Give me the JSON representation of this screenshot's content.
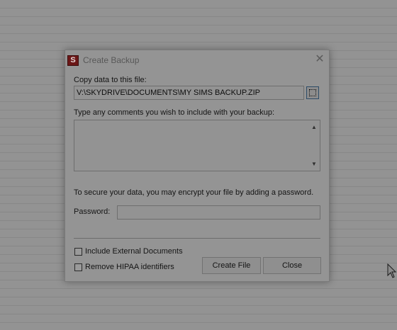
{
  "dialog": {
    "title": "Create Backup",
    "app_icon_letter": "S",
    "close_glyph": "✕",
    "copy_label": "Copy data to this file:",
    "file_path": "V:\\SKYDRIVE\\DOCUMENTS\\MY SIMS BACKUP.ZIP",
    "comments_label": "Type any comments you wish to include with your backup:",
    "comments_value": "",
    "encrypt_note": "To secure your data, you may encrypt your file by adding a password.",
    "password_label": "Password:",
    "password_value": "",
    "include_external_label": "Include External Documents",
    "include_external_checked": false,
    "remove_hipaa_label": "Remove HIPAA identifiers",
    "remove_hipaa_checked": false,
    "create_button": "Create File",
    "close_button": "Close"
  },
  "icons": {
    "app": "app-logo-icon",
    "close": "close-icon",
    "browse": "browse-ellipsis-icon",
    "scroll_up": "scroll-up-arrow-icon",
    "scroll_down": "scroll-down-arrow-icon",
    "cursor": "mouse-pointer-icon"
  },
  "colors": {
    "app_icon_bg": "#6b1717",
    "browse_border": "#2d4c67",
    "overlay": "#929292"
  }
}
